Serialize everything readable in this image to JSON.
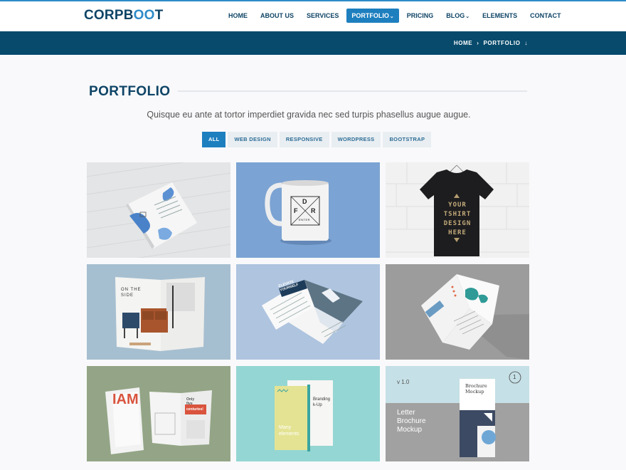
{
  "brand": {
    "logo_text_a": "CORPB",
    "logo_text_b": "OO",
    "logo_text_c": "T"
  },
  "nav": {
    "items": [
      {
        "label": "HOME"
      },
      {
        "label": "ABOUT US"
      },
      {
        "label": "SERVICES"
      },
      {
        "label": "PORTFOLIO",
        "caret": "⌄",
        "active": true
      },
      {
        "label": "PRICING"
      },
      {
        "label": "BLOG",
        "caret": "⌄"
      },
      {
        "label": "ELEMENTS"
      },
      {
        "label": "CONTACT"
      }
    ]
  },
  "breadcrumb": {
    "home": "HOME",
    "separator": "›",
    "current": "PORTFOLIO",
    "arrow": "↓"
  },
  "page": {
    "title": "PORTFOLIO",
    "subtitle": "Quisque eu ante at tortor imperdiet gravida nec sed turpis phasellus augue augue."
  },
  "filters": [
    "ALL",
    "WEB DESIGN",
    "RESPONSIVE",
    "WORDPRESS",
    "BOOTSTRAP"
  ],
  "portfolio": {
    "mug_text": {
      "top": "D",
      "left": "F",
      "right": "R",
      "bottom": "ENTER"
    },
    "tshirt_text": [
      "YOUR",
      "TSHIRT",
      "DESIGN",
      "HERE"
    ],
    "magazine1": [
      "ON THE",
      "SIDE"
    ],
    "magazine2": [
      "ELEVATE",
      "YOURSELF"
    ],
    "magazine3": {
      "big": "IAM",
      "badge1": "Only",
      "badge2": "five",
      "badge3": "centuries!"
    },
    "notebook": {
      "left": "Many",
      "left2": "elements",
      "right1": "Branding",
      "right2": "k-Up"
    },
    "brochure": {
      "version": "v 1.0",
      "line1": "Letter",
      "line2": "Brochure",
      "line3": "Mockup",
      "cover1": "Brochure",
      "cover2": "Mockup",
      "number": "1"
    }
  },
  "colors": {
    "brand_dark": "#0e4466",
    "accent": "#1e7fbf",
    "breadbar": "#074a6c"
  }
}
